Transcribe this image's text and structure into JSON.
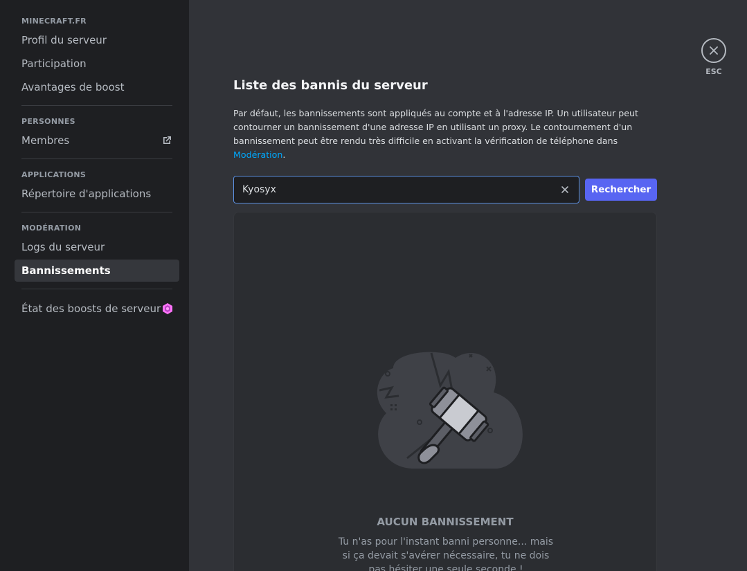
{
  "sidebar": {
    "sections": [
      {
        "header": "MINECRAFT.FR",
        "items": [
          {
            "label": "Profil du serveur"
          },
          {
            "label": "Participation"
          },
          {
            "label": "Avantages de boost"
          }
        ]
      },
      {
        "header": "PERSONNES",
        "items": [
          {
            "label": "Membres",
            "icon": "external-link-icon"
          }
        ]
      },
      {
        "header": "APPLICATIONS",
        "items": [
          {
            "label": "Répertoire d'applications"
          }
        ]
      },
      {
        "header": "MODÉRATION",
        "items": [
          {
            "label": "Logs du serveur"
          },
          {
            "label": "Bannissements",
            "selected": true
          }
        ]
      }
    ],
    "footer_item": {
      "label": "État des boosts de serveur",
      "icon": "boost-gem-icon"
    }
  },
  "close": {
    "esc_label": "ESC"
  },
  "main": {
    "title": "Liste des bannis du serveur",
    "description": "Par défaut, les bannissements sont appliqués au compte et à l'adresse IP. Un utilisateur peut contourner un bannissement d'une adresse IP en utilisant un proxy. Le contournement d'un bannissement peut être rendu très difficile en activant la vérification de téléphone dans ",
    "description_link": "Modération",
    "description_end": ".",
    "search": {
      "value": "Kyosyx",
      "button_label": "Rechercher"
    },
    "empty": {
      "title": "AUCUN BANNISSEMENT",
      "text": "Tu n'as pour l'instant banni personne... mais si ça devait s'avérer nécessaire, tu ne dois pas hésiter une seule seconde !"
    }
  },
  "colors": {
    "accent": "#5865f2",
    "link": "#00a8fc",
    "boost": "#ff73fa"
  }
}
